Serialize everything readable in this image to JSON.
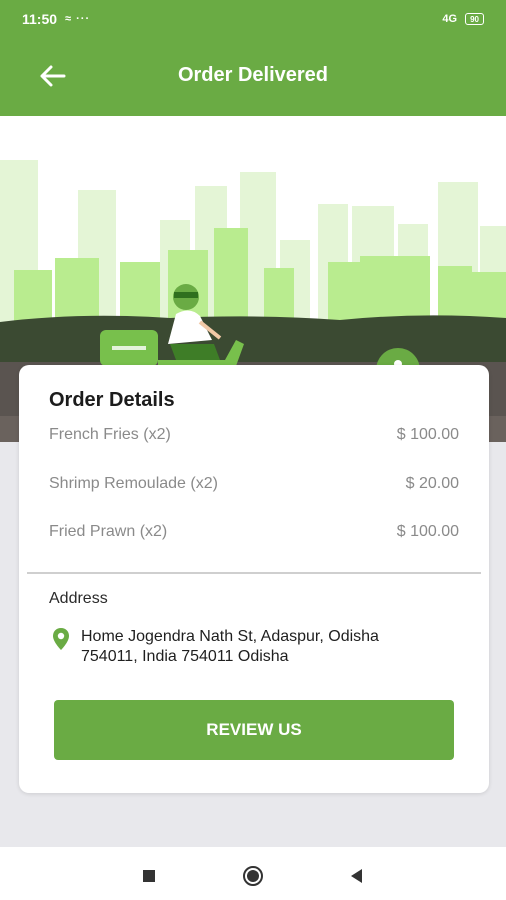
{
  "status_bar": {
    "time": "11:50",
    "icons": "≈ ···",
    "signal": "4G",
    "battery": "90"
  },
  "app_bar": {
    "back_icon": "arrow-left-icon",
    "title": "Order Delivered"
  },
  "banner": {
    "illustration": "delivery-scooter-city-illustration"
  },
  "order_details": {
    "heading": "Order Details",
    "items": [
      {
        "name": "French Fries (x2)",
        "price": "$ 100.00"
      },
      {
        "name": "Shrimp Remoulade (x2)",
        "price": "$ 20.00"
      },
      {
        "name": "Fried Prawn (x2)",
        "price": "$ 100.00"
      }
    ],
    "address_label": "Address",
    "address_line1": "Home Jogendra Nath St, Adaspur, Odisha",
    "address_line2": "754011, India 754011 Odisha",
    "review_button": "REVIEW US"
  },
  "colors": {
    "brand": "#6aab44",
    "muted_text": "#8a8a8a"
  }
}
